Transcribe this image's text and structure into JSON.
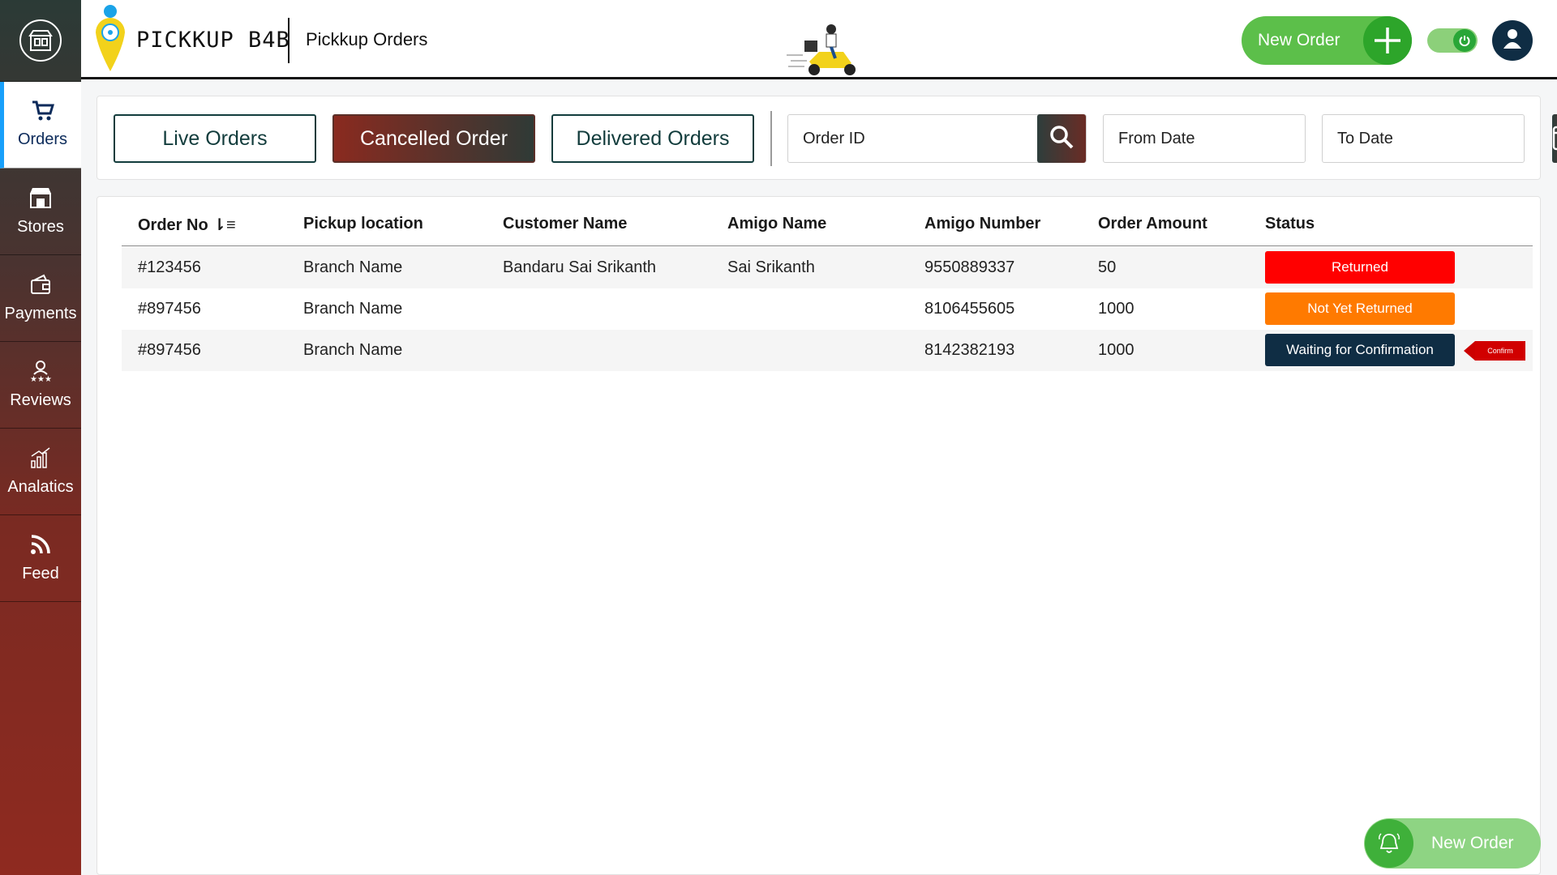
{
  "app": {
    "brand_name": "PICKKUP B4B",
    "page_title": "Pickkup Orders",
    "new_order_label": "New Order"
  },
  "sidebar": {
    "items": [
      {
        "label": "Orders",
        "icon": "cart-icon"
      },
      {
        "label": "Stores",
        "icon": "store-icon"
      },
      {
        "label": "Payments",
        "icon": "wallet-icon"
      },
      {
        "label": "Reviews",
        "icon": "reviews-icon"
      },
      {
        "label": "Analatics",
        "icon": "analytics-icon"
      },
      {
        "label": "Feed",
        "icon": "rss-icon"
      }
    ],
    "active": "Orders"
  },
  "filters": {
    "tabs": [
      "Live Orders",
      "Cancelled Order",
      "Delivered Orders"
    ],
    "active_tab": "Cancelled Order",
    "order_id_placeholder": "Order ID",
    "from_date_placeholder": "From Date",
    "to_date_placeholder": "To Date"
  },
  "table": {
    "columns": [
      "Order No",
      "Pickup location",
      "Customer Name",
      "Amigo Name",
      "Amigo Number",
      "Order Amount",
      "Status"
    ],
    "rows": [
      {
        "order_no": "#123456",
        "pickup": "Branch Name",
        "customer": "Bandaru Sai Srikanth",
        "amigo": "Sai Srikanth",
        "amigo_number": "9550889337",
        "amount": "50",
        "status": "Returned",
        "status_color": "#ff0000"
      },
      {
        "order_no": "#897456",
        "pickup": "Branch Name",
        "customer": "",
        "amigo": "",
        "amigo_number": "8106455605",
        "amount": "1000",
        "status": "Not Yet Returned",
        "status_color": "#ff7a00"
      },
      {
        "order_no": "#897456",
        "pickup": "Branch Name",
        "customer": "",
        "amigo": "",
        "amigo_number": "8142382193",
        "amount": "1000",
        "status": "Waiting for Confirmation",
        "status_color": "#0f2d44",
        "action": "Confirm"
      }
    ]
  },
  "colors": {
    "accent_green": "#5cbf4a",
    "brand_dark": "#123c3c",
    "active_tab_red": "#8a2a1f"
  }
}
